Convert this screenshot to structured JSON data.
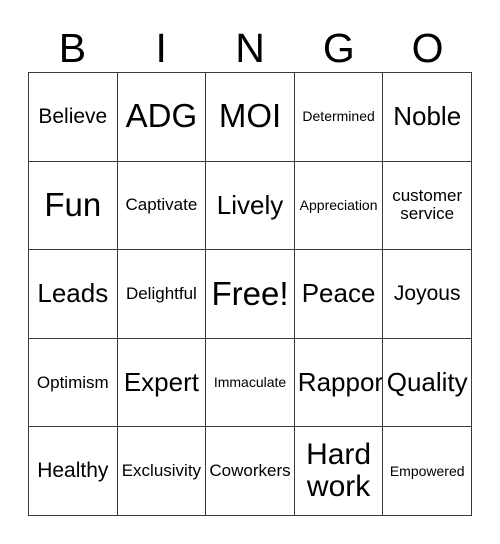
{
  "card": {
    "header_letters": [
      "B",
      "I",
      "N",
      "G",
      "O"
    ],
    "rows": [
      [
        {
          "text": "Believe",
          "size": "md"
        },
        {
          "text": "ADG",
          "size": "xxl"
        },
        {
          "text": "MOI",
          "size": "xxl"
        },
        {
          "text": "Determined",
          "size": "xs"
        },
        {
          "text": "Noble",
          "size": "lg"
        }
      ],
      [
        {
          "text": "Fun",
          "size": "xxl"
        },
        {
          "text": "Captivate",
          "size": "sm"
        },
        {
          "text": "Lively",
          "size": "lg"
        },
        {
          "text": "Appreciation",
          "size": "xs"
        },
        {
          "text": "customer\nservice",
          "size": "sm"
        }
      ],
      [
        {
          "text": "Leads",
          "size": "lg"
        },
        {
          "text": "Delightful",
          "size": "sm"
        },
        {
          "text": "Free!",
          "size": "xxl"
        },
        {
          "text": "Peace",
          "size": "lg"
        },
        {
          "text": "Joyous",
          "size": "md"
        }
      ],
      [
        {
          "text": "Optimism",
          "size": "sm"
        },
        {
          "text": "Expert",
          "size": "lg"
        },
        {
          "text": "Immaculate",
          "size": "xs"
        },
        {
          "text": "Rapport",
          "size": "lg"
        },
        {
          "text": "Quality",
          "size": "lg"
        }
      ],
      [
        {
          "text": "Healthy",
          "size": "md"
        },
        {
          "text": "Exclusivity",
          "size": "sm"
        },
        {
          "text": "Coworkers",
          "size": "sm"
        },
        {
          "text": "Hard\nwork",
          "size": "xl"
        },
        {
          "text": "Empowered",
          "size": "xs"
        }
      ]
    ],
    "colors": {
      "text": "#000000",
      "grid_line": "#3a3a3a",
      "background": "#ffffff"
    }
  }
}
